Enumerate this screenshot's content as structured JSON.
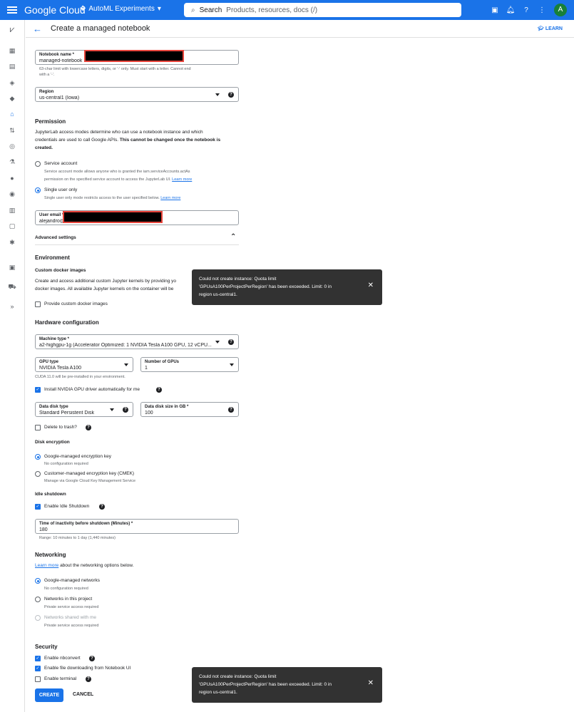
{
  "topbar": {
    "logo": "Google Cloud",
    "project": "AutoML Experiments",
    "search_label": "Search",
    "search_placeholder": "Products, resources, docs (/)",
    "avatar": "A"
  },
  "header": {
    "title": "Create a managed notebook",
    "learn": "LEARN"
  },
  "form": {
    "notebook_name": {
      "label": "Notebook name *",
      "value": "managed-notebook"
    },
    "name_hint": "63-char limit with lowercase letters, digits, or '-' only. Must start with a letter. Cannot end",
    "name_hint2": "with a '-'.",
    "region": {
      "label": "Region",
      "value": "us-central1 (Iowa)"
    },
    "permission": {
      "heading": "Permission",
      "desc1": "JupyterLab access modes determine who can use a notebook instance and which",
      "desc2": "credentials are used to call Google APIs.",
      "desc2_bold": "This cannot be changed once the notebook is",
      "desc3_bold": "created.",
      "service_account": "Service account",
      "service_desc1": "Service account mode allows anyone who is granted the iam.serviceAccounts.actAs",
      "service_desc2": "permission on the specified service account to access the JupyterLab UI.",
      "single_user": "Single user only",
      "single_desc": "Single user only mode restricts access to the user specified below.",
      "learn_more": "Learn more",
      "user_email_label": "User email *",
      "user_email_value": "alejandro@"
    },
    "advanced": "Advanced settings",
    "environment": {
      "heading": "Environment",
      "custom_docker": "Custom docker images",
      "desc1": "Create and access additional custom Jupyter kernels by providing yo",
      "desc2": "docker images. All available Jupyter kernels on the container will be",
      "provide": "Provide custom docker images"
    },
    "hardware": {
      "heading": "Hardware configuration",
      "machine_type_label": "Machine type *",
      "machine_type_value": "a2-highgpu-1g (Accelerator Optimized: 1 NVIDIA Tesla A100 GPU, 12 vCPU...",
      "gpu_type_label": "GPU type",
      "gpu_type_value": "NVIDIA Tesla A100",
      "num_gpus_label": "Number of GPUs",
      "num_gpus_value": "1",
      "cuda_note": "CUDA 11.0 will be pre-installed in your environment.",
      "install_driver": "Install NVIDIA GPU driver automatically for me",
      "disk_type_label": "Data disk type",
      "disk_type_value": "Standard Persistent Disk",
      "disk_size_label": "Data disk size in GB *",
      "disk_size_value": "100",
      "delete_trash": "Delete to trash?"
    },
    "encryption": {
      "heading": "Disk encryption",
      "google_key": "Google-managed encryption key",
      "google_key_desc": "No configuration required",
      "cmek": "Customer-managed encryption key (CMEK)",
      "cmek_desc": "Manage via Google Cloud Key Management Service"
    },
    "idle": {
      "heading": "Idle shutdown",
      "enable": "Enable Idle Shutdown",
      "time_label": "Time of inactivity before shutdown (Minutes) *",
      "time_value": "180",
      "range": "Range: 10 minutes to 1 day (1,440 minutes)"
    },
    "networking": {
      "heading": "Networking",
      "learn_more": "Learn more",
      "about": "about the networking options below.",
      "google_networks": "Google-managed networks",
      "google_networks_desc": "No configuration required",
      "project_networks": "Networks in this project",
      "project_networks_desc": "Private service access required",
      "shared_networks": "Networks shared with me",
      "shared_networks_desc": "Private service access required"
    },
    "security": {
      "heading": "Security",
      "nbconvert": "Enable nbconvert",
      "file_download": "Enable file downloading from Notebook UI",
      "terminal": "Enable terminal"
    },
    "create": "CREATE",
    "cancel": "CANCEL"
  },
  "toast": {
    "line1": "Could not create instance: Quota limit",
    "line2": "'GPUsA100PerProjectPerRegion' has been exceeded. Limit: 0 in",
    "line3": "region us-central1."
  },
  "colors": {
    "primary": "#1a73e8",
    "toast_bg": "#323232",
    "redaction_border": "#e8453c"
  }
}
